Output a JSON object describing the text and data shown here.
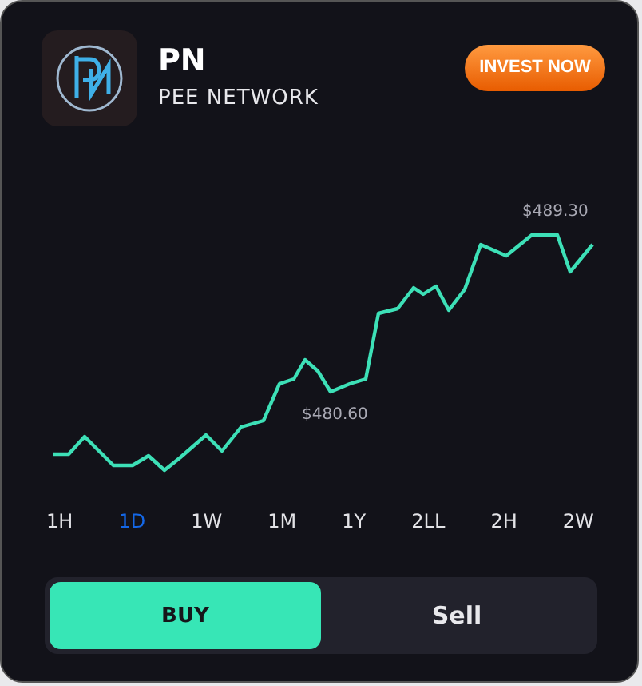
{
  "coin": {
    "symbol": "PN",
    "name": "PEE NETWORK"
  },
  "invest_button": "INVEST NOW",
  "chart": {
    "kind": "picture",
    "high_label": "$489.30",
    "low_label": "$480.60"
  },
  "ranges": [
    {
      "label": "1H",
      "selected": false
    },
    {
      "label": "1D",
      "selected": true
    },
    {
      "label": "1W",
      "selected": false
    },
    {
      "label": "1M",
      "selected": false
    },
    {
      "label": "1Y",
      "selected": false
    },
    {
      "label": "2LL",
      "selected": false
    },
    {
      "label": "2H",
      "selected": false
    },
    {
      "label": "2W",
      "selected": false
    }
  ],
  "actions": [
    {
      "label": "BUY",
      "selected": true
    },
    {
      "label": "Sell",
      "selected": false
    }
  ]
}
